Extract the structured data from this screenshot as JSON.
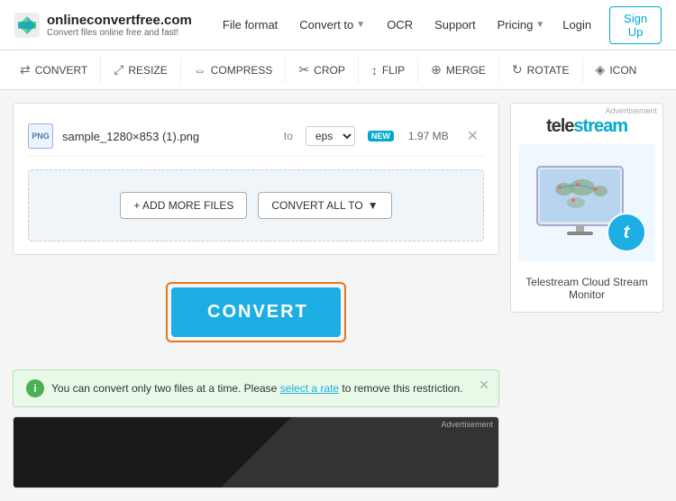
{
  "header": {
    "logo": {
      "title": "onlineconvertfree.com",
      "subtitle": "Convert files online free and fast!"
    },
    "nav": [
      {
        "label": "File format",
        "hasDropdown": false
      },
      {
        "label": "Convert to",
        "hasDropdown": true
      },
      {
        "label": "OCR",
        "hasDropdown": false
      },
      {
        "label": "Support",
        "hasDropdown": false
      },
      {
        "label": "Pricing",
        "hasDropdown": true
      }
    ],
    "login": "Login",
    "signup": "Sign Up"
  },
  "toolbar": {
    "items": [
      {
        "label": "CONVERT",
        "icon": "⇄"
      },
      {
        "label": "RESIZE",
        "icon": "⤢"
      },
      {
        "label": "COMPRESS",
        "icon": "⇔"
      },
      {
        "label": "CROP",
        "icon": "✂"
      },
      {
        "label": "FLIP",
        "icon": "↕"
      },
      {
        "label": "MERGE",
        "icon": "⊕"
      },
      {
        "label": "ROTATE",
        "icon": "↻"
      },
      {
        "label": "ICON",
        "icon": "◈"
      }
    ]
  },
  "file_card": {
    "file": {
      "name": "sample_1280×853 (1).png",
      "format_label": "to",
      "format_value": "eps",
      "new_badge": "NEW",
      "size": "1.97 MB"
    },
    "add_files_btn": "+ ADD MORE FILES",
    "convert_all_btn": "CONVERT ALL TO"
  },
  "convert_btn": "CONVERT",
  "info_banner": {
    "text": "You can convert only two files at a time. Please",
    "link_text": "select a rate",
    "text_after": "to remove this restriction."
  },
  "sidebar_ad": {
    "ad_label": "Advertisement",
    "brand": "telestream",
    "title": "Telestream Cloud Stream Monitor"
  },
  "bottom_ad": {
    "ad_label": "Advertisement"
  }
}
